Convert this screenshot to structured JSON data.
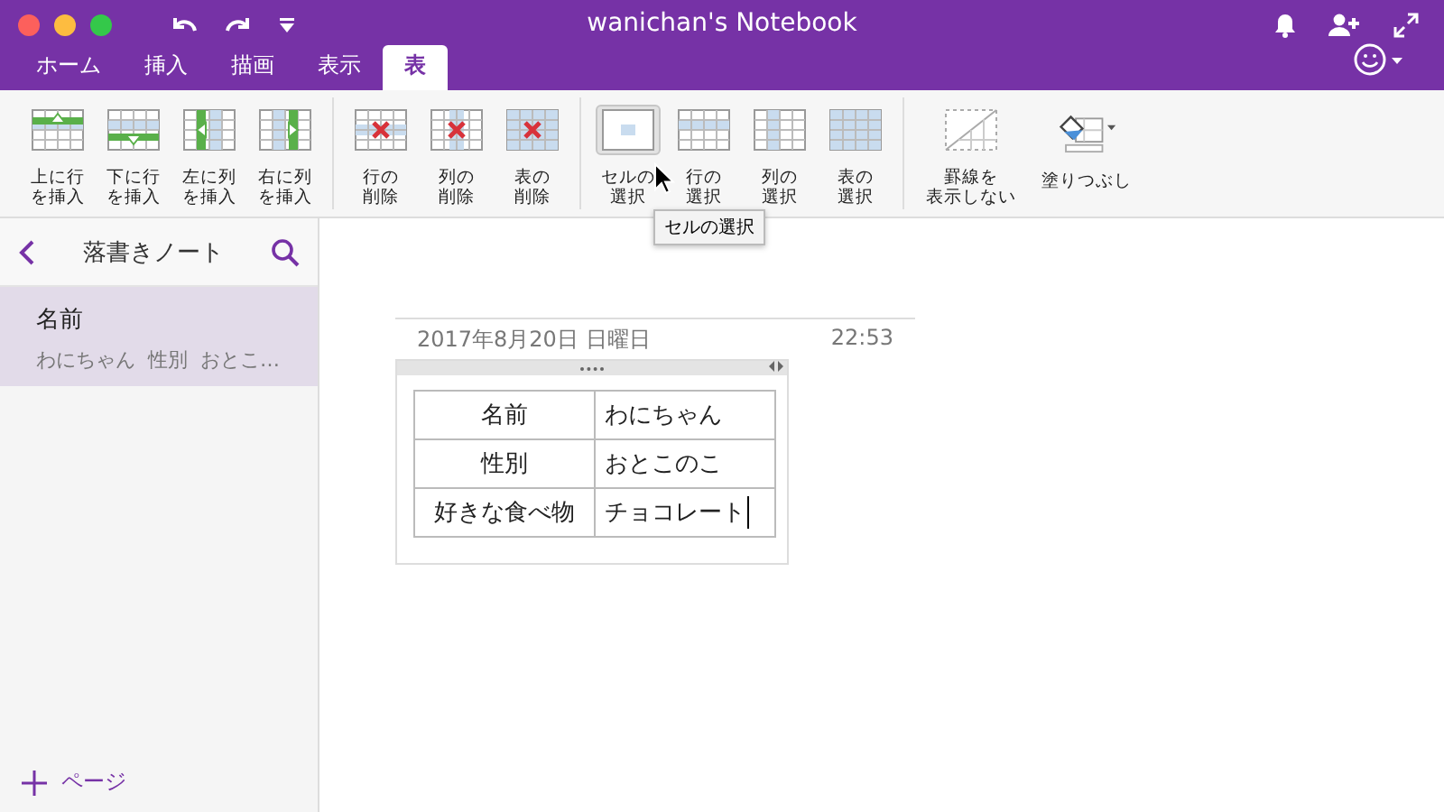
{
  "window": {
    "title": "wanichan's Notebook"
  },
  "tabs": [
    {
      "label": "ホーム",
      "selected": false
    },
    {
      "label": "挿入",
      "selected": false
    },
    {
      "label": "描画",
      "selected": false
    },
    {
      "label": "表示",
      "selected": false
    },
    {
      "label": "表",
      "selected": true
    }
  ],
  "ribbon": {
    "groups": [
      {
        "buttons": [
          {
            "kind": "row-above",
            "lines": [
              "上に行",
              "を挿入"
            ],
            "pressed": false
          },
          {
            "kind": "row-below",
            "lines": [
              "下に行",
              "を挿入"
            ],
            "pressed": false
          },
          {
            "kind": "col-left",
            "lines": [
              "左に列",
              "を挿入"
            ],
            "pressed": false
          },
          {
            "kind": "col-right",
            "lines": [
              "右に列",
              "を挿入"
            ],
            "pressed": false
          }
        ]
      },
      {
        "buttons": [
          {
            "kind": "del-row",
            "lines": [
              "行の",
              "削除"
            ],
            "pressed": false
          },
          {
            "kind": "del-col",
            "lines": [
              "列の",
              "削除"
            ],
            "pressed": false
          },
          {
            "kind": "del-table",
            "lines": [
              "表の",
              "削除"
            ],
            "pressed": false
          }
        ]
      },
      {
        "buttons": [
          {
            "kind": "sel-cell",
            "lines": [
              "セルの",
              "選択"
            ],
            "pressed": true
          },
          {
            "kind": "sel-row",
            "lines": [
              "行の",
              "選択"
            ],
            "pressed": false
          },
          {
            "kind": "sel-col",
            "lines": [
              "列の",
              "選択"
            ],
            "pressed": false
          },
          {
            "kind": "sel-table",
            "lines": [
              "表の",
              "選択"
            ],
            "pressed": false
          }
        ]
      },
      {
        "buttons": [
          {
            "kind": "no-borders",
            "lines": [
              "罫線を",
              "表示しない"
            ],
            "pressed": false
          },
          {
            "kind": "fill",
            "lines": [
              "塗りつぶし"
            ],
            "pressed": false
          }
        ]
      }
    ]
  },
  "tooltip": "セルの選択",
  "sidebar": {
    "title": "落書きノート",
    "pages": [
      {
        "title": "名前",
        "preview": "わにちゃん  性別  おとこ…",
        "selected": true
      }
    ],
    "add_page": "ページ"
  },
  "note": {
    "date": "2017年8月20日 日曜日",
    "time": "22:53",
    "table": {
      "rows": [
        [
          "名前",
          "わにちゃん"
        ],
        [
          "性別",
          "おとこのこ"
        ],
        [
          "好きな食べ物",
          "チョコレート"
        ]
      ]
    }
  }
}
